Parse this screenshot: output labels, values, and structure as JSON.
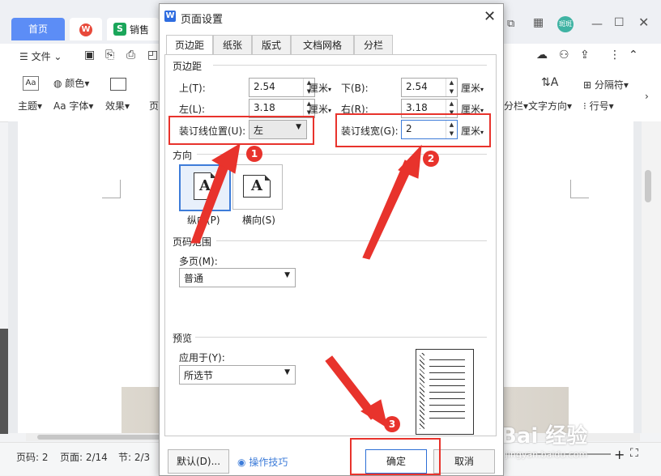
{
  "app": {
    "tabs": [
      {
        "label": "首页"
      },
      {
        "label": ""
      },
      {
        "label": "销售"
      }
    ],
    "ribbon": {
      "file_menu": "文件",
      "theme": "主题",
      "color": "颜色",
      "font": "字体",
      "effect": "效果",
      "page_prefix": "页",
      "text_direction": "文字方向",
      "columns": "分栏",
      "separator": "分隔符",
      "line_number": "行号"
    },
    "user_badge": "斑斑",
    "status": {
      "page_code": "页码: 2",
      "page_count": "页面: 2/14",
      "section": "节: 2/3"
    }
  },
  "dialog": {
    "title": "页面设置",
    "tabs": [
      {
        "label": "页边距",
        "active": true
      },
      {
        "label": "纸张"
      },
      {
        "label": "版式"
      },
      {
        "label": "文档网格"
      },
      {
        "label": "分栏"
      }
    ],
    "margins": {
      "heading": "页边距",
      "top_label": "上(T):",
      "top_value": "2.54",
      "bottom_label": "下(B):",
      "bottom_value": "2.54",
      "left_label": "左(L):",
      "left_value": "3.18",
      "right_label": "右(R):",
      "right_value": "3.18",
      "unit": "厘米",
      "gutter_pos_label": "装订线位置(U):",
      "gutter_pos_value": "左",
      "gutter_width_label": "装订线宽(G):",
      "gutter_width_value": "2"
    },
    "orientation": {
      "heading": "方向",
      "portrait": "纵向(P)",
      "landscape": "横向(S)",
      "glyph": "A"
    },
    "page_range": {
      "heading": "页码范围",
      "multi_label": "多页(M):",
      "multi_value": "普通"
    },
    "preview": {
      "heading": "预览",
      "apply_label": "应用于(Y):",
      "apply_value": "所选节"
    },
    "buttons": {
      "default": "默认(D)...",
      "tips": "操作技巧",
      "ok": "确定",
      "cancel": "取消"
    }
  },
  "annotations": {
    "step1": "1",
    "step2": "2",
    "step3": "3",
    "color": "#e8332c"
  },
  "watermark": {
    "text": "Bai 经验",
    "sub": "jingyan.baidu.com"
  }
}
